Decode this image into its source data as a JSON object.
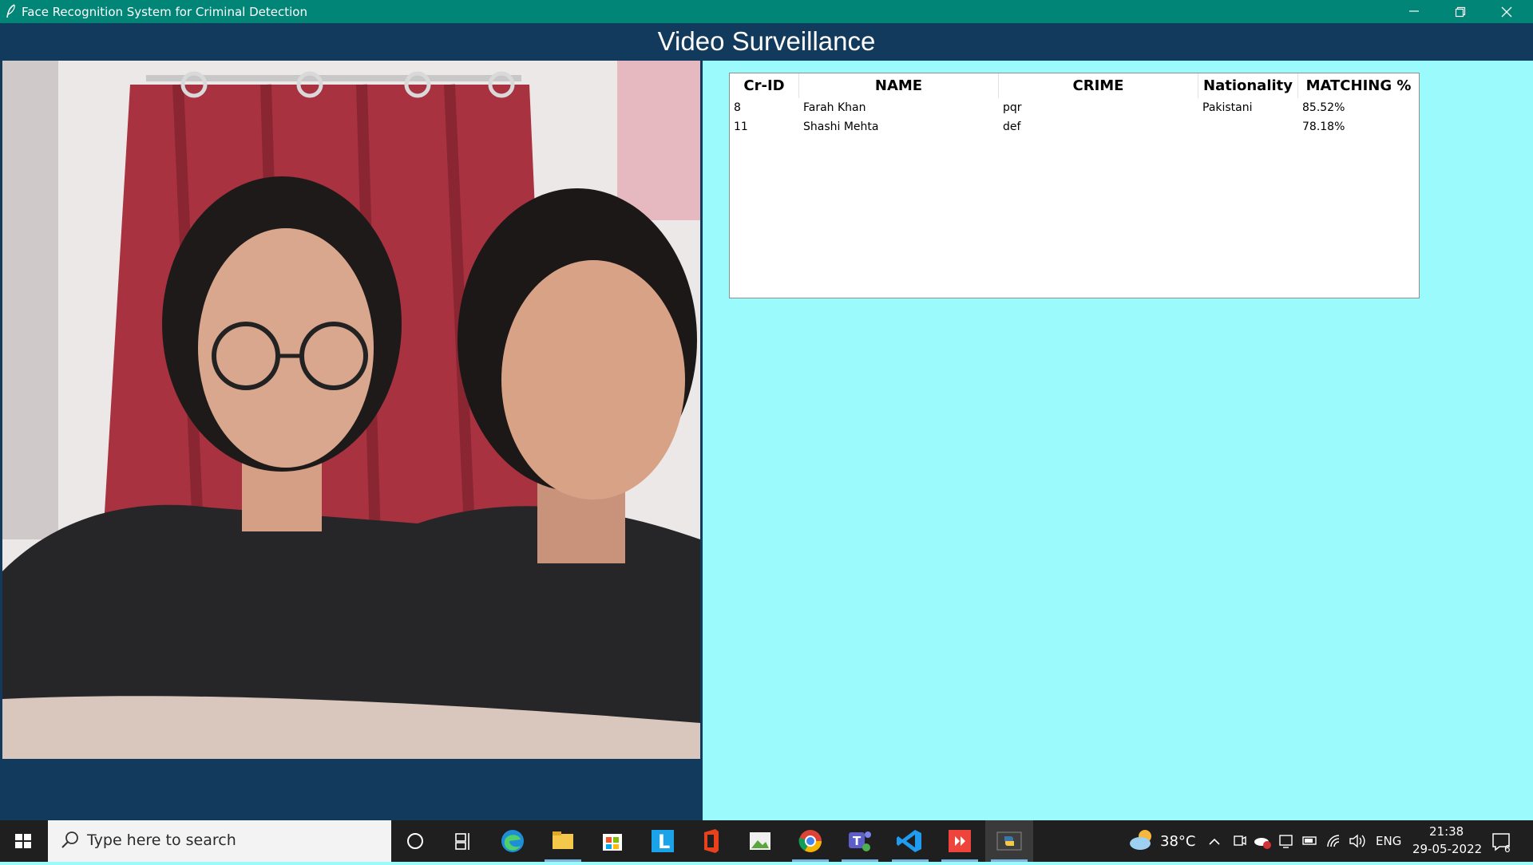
{
  "window": {
    "title": "Face Recognition System for Criminal Detection",
    "app_icon": "feather-icon",
    "controls": [
      "minimize-icon",
      "restore-icon",
      "close-icon"
    ]
  },
  "header": {
    "title": "Video Surveillance"
  },
  "video": {
    "content": "webcam-feed"
  },
  "results_table": {
    "columns": [
      "Cr-ID",
      "NAME",
      "CRIME",
      "Nationality",
      "MATCHING %"
    ],
    "rows": [
      [
        "8",
        "Farah Khan",
        "pqr",
        "Pakistani",
        "85.52%"
      ],
      [
        "11",
        "Shashi Mehta",
        "def",
        "",
        "78.18%"
      ]
    ]
  },
  "taskbar": {
    "search_placeholder": "Type here to search",
    "apps": [
      "windows-start-icon",
      "cortana-icon",
      "task-view-icon",
      "edge-icon",
      "file-explorer-icon",
      "store-icon",
      "l-app-icon",
      "office-icon",
      "photos-icon",
      "chrome-icon",
      "teams-icon",
      "vscode-icon",
      "anydesk-icon",
      "python-icon"
    ],
    "weather": {
      "temp": "38°C",
      "icon": "weather-cloud-sun-icon"
    },
    "language": "ENG",
    "time": "21:38",
    "date": "29-05-2022",
    "notifications": "6"
  },
  "colors": {
    "titlebar": "#008577",
    "header": "#123a5d",
    "background": "#9bfbfc",
    "taskbar": "#1f1f1f"
  }
}
